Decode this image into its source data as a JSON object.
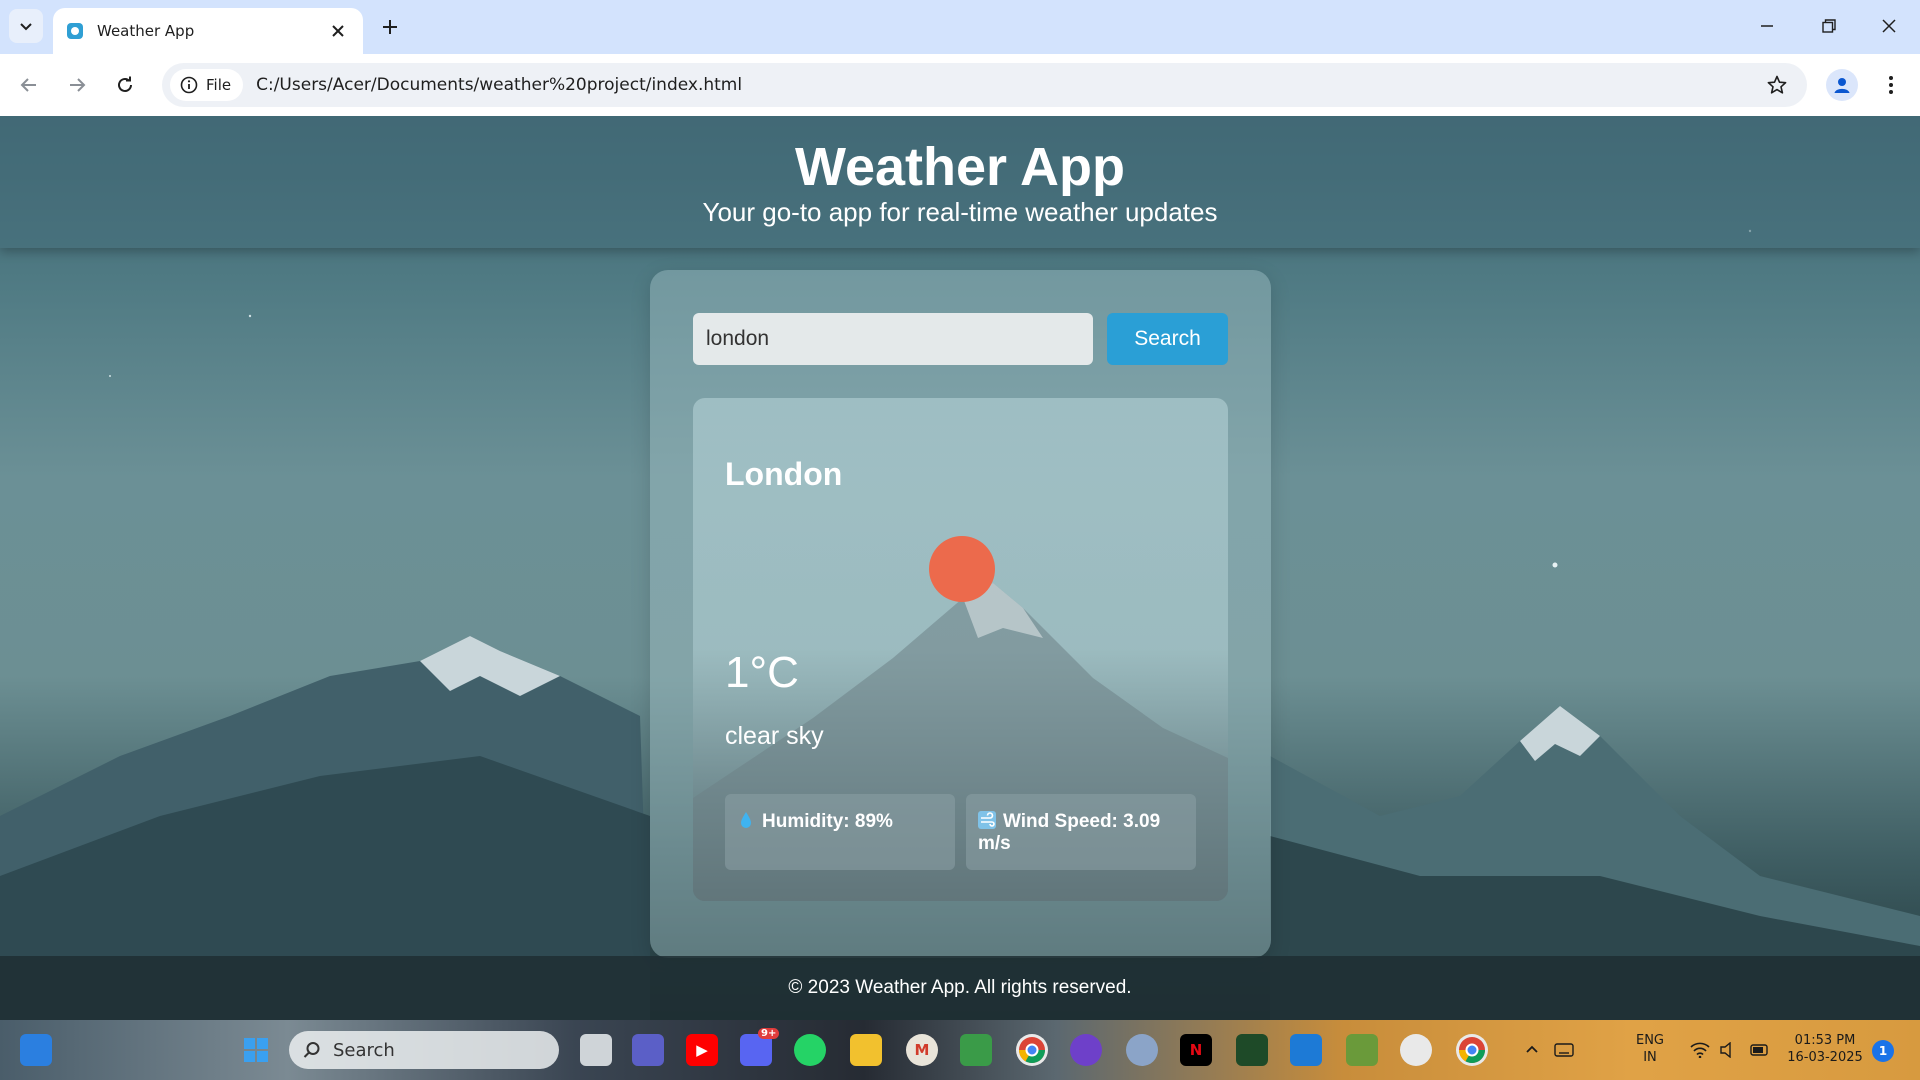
{
  "browser": {
    "tab_title": "Weather App",
    "address_chip": "File",
    "url": "C:/Users/Acer/Documents/weather%20project/index.html"
  },
  "header": {
    "title": "Weather App",
    "subtitle": "Your go-to app for real-time weather updates"
  },
  "search": {
    "value": "london",
    "button_label": "Search"
  },
  "weather": {
    "city": "London",
    "icon": "sun-icon",
    "icon_color": "#ec6a4c",
    "temperature": "1°C",
    "description": "clear sky",
    "humidity": "Humidity: 89%",
    "wind_speed": "Wind Speed: 3.09 m/s"
  },
  "footer": {
    "text": "© 2023 Weather App. All rights reserved."
  },
  "taskbar": {
    "search_label": "Search",
    "language": [
      "ENG",
      "IN"
    ],
    "time": "01:53 PM",
    "date": "16-03-2025",
    "notification_count": "1",
    "discord_badge": "9+"
  },
  "colors": {
    "accent": "#2a9fd6",
    "chrome_tabstrip": "#d3e3fd"
  }
}
